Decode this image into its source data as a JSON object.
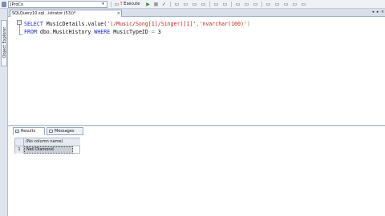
{
  "toolbar": {
    "database": "JProCo",
    "dropdown_glyph": "▾",
    "execute_label": "Execute",
    "execute_glyph": "!",
    "run_glyph": "▶",
    "stop_glyph": "■",
    "check_glyph": "✓",
    "buttons": [
      "▭",
      "▭",
      "▭",
      "▭",
      "▭",
      "▭",
      "▭",
      "▭",
      "▭",
      "▭",
      "▭",
      "▭",
      "▭",
      "▭",
      "▭"
    ]
  },
  "sidebar": {
    "object_explorer_label": "Object Explorer"
  },
  "document_tab": {
    "title": "SQLQuery10.sql...istrator (53))*",
    "close_glyph": "×",
    "scroll_left_glyph": "◂",
    "scroll_right_glyph": "▸",
    "window_close_glyph": "×"
  },
  "editor": {
    "collapse_glyph": "−",
    "line1": {
      "select": "SELECT ",
      "expr": "MusicDetails.value(",
      "path": "'(/Music/Song[1]/Singer)[1]'",
      "comma": ",",
      "type": "'nvarchar(100)'",
      "close": ")"
    },
    "line2": {
      "from": "FROM ",
      "table": "dbo.MusicHistory ",
      "where": "WHERE ",
      "column": "MusicTypeID ",
      "op": "= ",
      "value": "3"
    }
  },
  "results_pane": {
    "tabs": [
      {
        "label": "Results",
        "active": true
      },
      {
        "label": "Messages",
        "active": false
      }
    ],
    "grid": {
      "column_header": "(No column name)",
      "rows": [
        {
          "row_number": "1",
          "value": "Neil Diamond"
        }
      ]
    }
  },
  "colors": {
    "keyword": "#1a2cc8",
    "string": "#c4241b",
    "toolbar_bg": "#eef1f6",
    "selected_cell": "#c9cfd8"
  }
}
